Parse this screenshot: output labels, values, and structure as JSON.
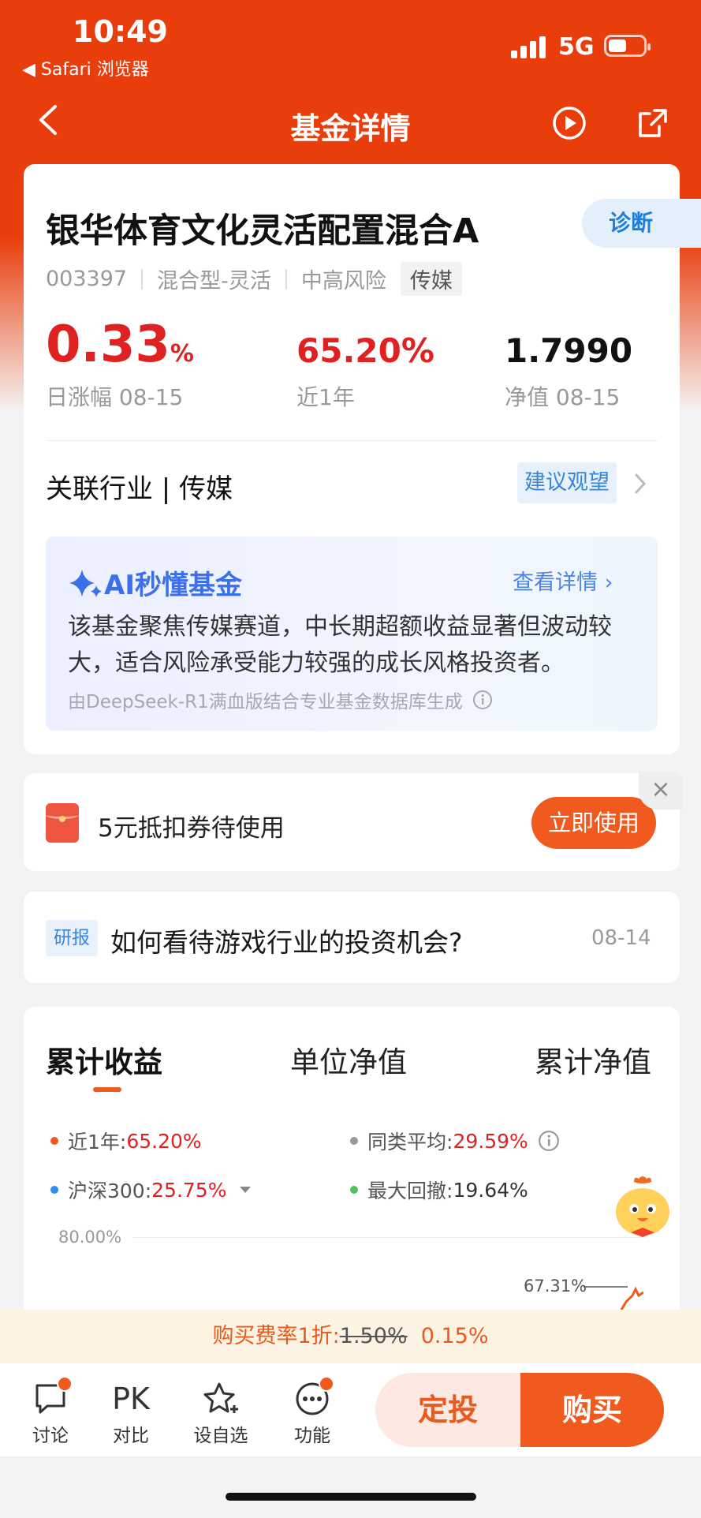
{
  "status": {
    "time": "10:49",
    "back_app": "◀ Safari 浏览器",
    "network": "5G"
  },
  "nav": {
    "title": "基金详情"
  },
  "fund": {
    "name": "银华体育文化灵活配置混合A",
    "diagnose": "诊断",
    "code": "003397",
    "type": "混合型-灵活",
    "risk": "中高风险",
    "tag": "传媒",
    "daily_change": "0.33",
    "daily_change_unit": "%",
    "daily_label": "日涨幅 08-15",
    "year_return": "65.20%",
    "year_label": "近1年",
    "nav_value": "1.7990",
    "nav_label": "净值 08-15",
    "industry": "关联行业 | 传媒",
    "advice": "建议观望"
  },
  "ai": {
    "title": "AI秒懂基金",
    "more": "查看详情",
    "text": "该基金聚焦传媒赛道，中长期超额收益显著但波动较大，适合风险承受能力较强的成长风格投资者。",
    "source": "由DeepSeek-R1满血版结合专业基金数据库生成"
  },
  "coupon": {
    "text": "5元抵扣券待使用",
    "button": "立即使用",
    "close": "×"
  },
  "report": {
    "tag": "研报",
    "title": "如何看待游戏行业的投资机会?",
    "date": "08-14"
  },
  "perf": {
    "tabs": [
      "累计收益",
      "单位净值",
      "累计净值"
    ],
    "legend": {
      "year_label": "近1年:",
      "year_value": "65.20%",
      "avg_label": "同类平均:",
      "avg_value": "29.59%",
      "hs300_label": "沪深300:",
      "hs300_value": "25.75%",
      "drawdown_label": "最大回撤:",
      "drawdown_value": "19.64%"
    },
    "grid_top": "80.00%",
    "end_value": "67.31%"
  },
  "fee": {
    "prefix": "购买费率1折:",
    "original": "1.50%",
    "current": "0.15%"
  },
  "bottom": {
    "discuss": "讨论",
    "compare_icon": "PK",
    "compare": "对比",
    "watch": "设自选",
    "more": "功能",
    "sip": "定投",
    "buy": "购买"
  },
  "colors": {
    "brand": "#ea3d0c",
    "accent": "#f05a1e",
    "up": "#e02121",
    "link": "#3a86d6"
  }
}
